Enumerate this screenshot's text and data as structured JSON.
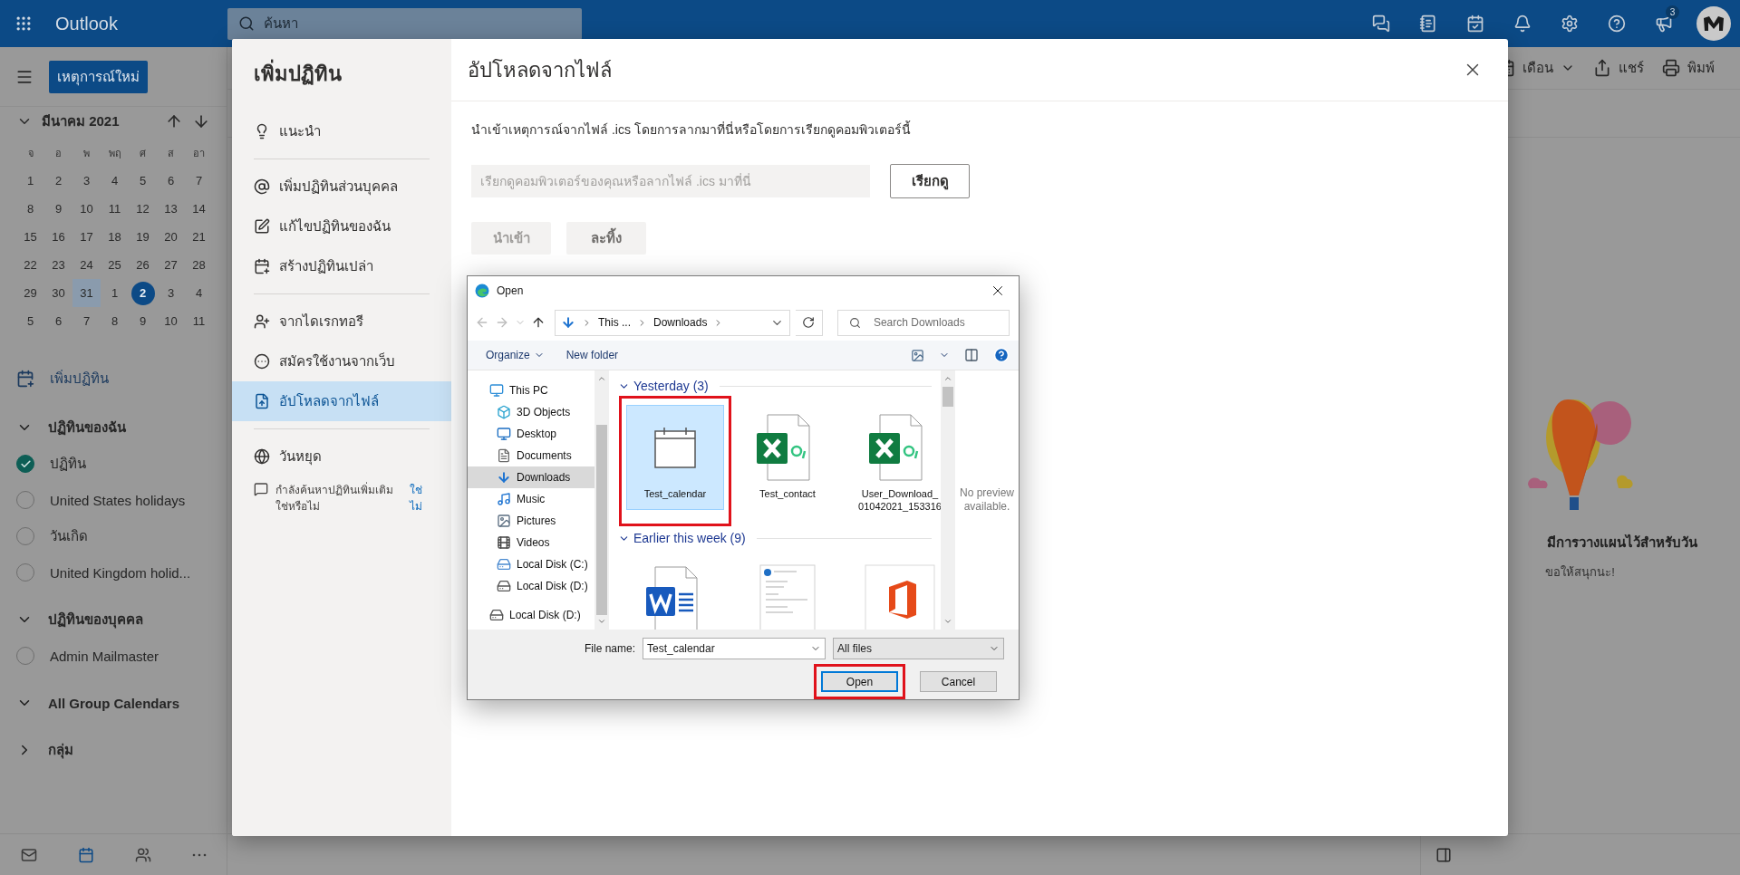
{
  "top_bar": {
    "app_name": "Outlook",
    "search": {
      "placeholder": "ค้นหา"
    },
    "icons": [
      {
        "kind": "chat"
      },
      {
        "kind": "notebook"
      },
      {
        "kind": "todo"
      },
      {
        "kind": "bell"
      },
      {
        "kind": "settings"
      },
      {
        "kind": "help"
      },
      {
        "kind": "megaphone",
        "badge": "3"
      }
    ]
  },
  "sidebar": {
    "new_event_button": "เหตุการณ์ใหม่",
    "mini_calendar": {
      "month": "มีนาคม 2021",
      "expanded": true,
      "weekdays": [
        "จ",
        "อ",
        "พ",
        "พฤ",
        "ศ",
        "ส",
        "อา"
      ],
      "weeks": [
        [
          {
            "day": "1",
            "selected": false,
            "today": false
          },
          {
            "day": "2",
            "selected": false,
            "today": false
          },
          {
            "day": "3",
            "selected": false,
            "today": false
          },
          {
            "day": "4",
            "selected": false,
            "today": false
          },
          {
            "day": "5",
            "selected": false,
            "today": false
          },
          {
            "day": "6",
            "selected": false,
            "today": false
          },
          {
            "day": "7",
            "selected": false,
            "today": false
          }
        ],
        [
          {
            "day": "8",
            "selected": false,
            "today": false
          },
          {
            "day": "9",
            "selected": false,
            "today": false
          },
          {
            "day": "10",
            "selected": false,
            "today": false
          },
          {
            "day": "11",
            "selected": false,
            "today": false
          },
          {
            "day": "12",
            "selected": false,
            "today": false
          },
          {
            "day": "13",
            "selected": false,
            "today": false
          },
          {
            "day": "14",
            "selected": false,
            "today": false
          }
        ],
        [
          {
            "day": "15",
            "selected": false,
            "today": false
          },
          {
            "day": "16",
            "selected": false,
            "today": false
          },
          {
            "day": "17",
            "selected": false,
            "today": false
          },
          {
            "day": "18",
            "selected": false,
            "today": false
          },
          {
            "day": "19",
            "selected": false,
            "today": false
          },
          {
            "day": "20",
            "selected": false,
            "today": false
          },
          {
            "day": "21",
            "selected": false,
            "today": false
          }
        ],
        [
          {
            "day": "22",
            "selected": false,
            "today": false
          },
          {
            "day": "23",
            "selected": false,
            "today": false
          },
          {
            "day": "24",
            "selected": false,
            "today": false
          },
          {
            "day": "25",
            "selected": false,
            "today": false
          },
          {
            "day": "26",
            "selected": false,
            "today": false
          },
          {
            "day": "27",
            "selected": false,
            "today": false
          },
          {
            "day": "28",
            "selected": false,
            "today": false
          }
        ],
        [
          {
            "day": "29",
            "selected": false,
            "today": false
          },
          {
            "day": "30",
            "selected": false,
            "today": false
          },
          {
            "day": "31",
            "selected": true,
            "today": false
          },
          {
            "day": "1",
            "selected": false,
            "today": false
          },
          {
            "day": "2",
            "selected": false,
            "today": true
          },
          {
            "day": "3",
            "selected": false,
            "today": false
          },
          {
            "day": "4",
            "selected": false,
            "today": false
          }
        ],
        [
          {
            "day": "5",
            "selected": false,
            "today": false
          },
          {
            "day": "6",
            "selected": false,
            "today": false
          },
          {
            "day": "7",
            "selected": false,
            "today": false
          },
          {
            "day": "8",
            "selected": false,
            "today": false
          },
          {
            "day": "9",
            "selected": false,
            "today": false
          },
          {
            "day": "10",
            "selected": false,
            "today": false
          },
          {
            "day": "11",
            "selected": false,
            "today": false
          }
        ]
      ]
    },
    "add_calendar": "เพิ่มปฏิทิน",
    "groups": [
      {
        "title": "ปฏิทินของฉัน",
        "expanded": true,
        "items": [
          {
            "label": "ปฏิทิน",
            "checked": true
          },
          {
            "label": "United States holidays",
            "checked": false
          },
          {
            "label": "วันเกิด",
            "checked": false
          },
          {
            "label": "United Kingdom holid...",
            "checked": false
          }
        ]
      },
      {
        "title": "ปฏิทินของบุคคล",
        "expanded": true,
        "items": [
          {
            "label": "Admin Mailmaster",
            "checked": false
          }
        ]
      },
      {
        "title": "All Group Calendars",
        "expanded": true
      },
      {
        "title": "กลุ่ม",
        "expanded": false
      }
    ],
    "bottom_nav": [
      {
        "kind": "mail",
        "selected": false
      },
      {
        "kind": "calendar",
        "selected": true
      },
      {
        "kind": "people",
        "selected": false
      },
      {
        "kind": "more",
        "selected": false
      }
    ]
  },
  "main": {
    "toolbar": [
      {
        "kind": "view",
        "label": "เดือน"
      },
      {
        "kind": "share",
        "label": "แชร์"
      },
      {
        "kind": "print",
        "label": "พิมพ์"
      }
    ],
    "day_pane": {
      "heading": "มีการวางแผนไว้สำหรับวัน",
      "subtext": "ขอให้สนุกนะ!"
    }
  },
  "add_calendar_dialog": {
    "title": "เพิ่มปฏิทิน",
    "menu_groups": [
      [
        {
          "label": "แนะนำ",
          "selected": false
        }
      ],
      [
        {
          "label": "เพิ่มปฏิทินส่วนบุคคล",
          "selected": false
        },
        {
          "label": "แก้ไขปฏิทินของฉัน",
          "selected": false
        },
        {
          "label": "สร้างปฏิทินเปล่า",
          "selected": false
        }
      ],
      [
        {
          "label": "จากไดเรกทอรี",
          "selected": false
        },
        {
          "label": "สมัครใช้งานจากเว็บ",
          "selected": false
        },
        {
          "label": "อัปโหลดจากไฟล์",
          "selected": true
        }
      ],
      [
        {
          "label": "วันหยุด",
          "selected": false
        }
      ]
    ],
    "feedback": {
      "text": "กำลังค้นหาปฏิทินเพิ่มเติมใช่หรือไม่",
      "links": [
        "ใช่",
        "ไม่"
      ]
    },
    "panel": {
      "title": "อัปโหลดจากไฟล์",
      "description": "นำเข้าเหตุการณ์จากไฟล์ .ics โดยการลากมาที่นี่หรือโดยการเรียกดูคอมพิวเตอร์นี้",
      "drop_field": {
        "placeholder": "เรียกดูคอมพิวเตอร์ของคุณหรือลากไฟล์ .ics มาที่นี่"
      },
      "browse_button": "เรียกดู",
      "actions": [
        {
          "label": "นำเข้า",
          "disabled": true
        },
        {
          "label": "ละทิ้ง",
          "disabled": false
        }
      ]
    }
  },
  "file_dialog": {
    "title": "Open",
    "address": [
      "This ...",
      "Downloads"
    ],
    "search": {
      "placeholder": "Search Downloads"
    },
    "toolbar": {
      "organize": "Organize",
      "new_folder": "New folder"
    },
    "nav_tree": [
      {
        "label": "This PC",
        "kind": "pc",
        "selected": false,
        "children": [
          {
            "label": "3D Objects",
            "kind": "objects",
            "selected": false
          },
          {
            "label": "Desktop",
            "kind": "desktop",
            "selected": false
          },
          {
            "label": "Documents",
            "kind": "documents",
            "selected": false
          },
          {
            "label": "Downloads",
            "kind": "downloads",
            "selected": true
          },
          {
            "label": "Music",
            "kind": "music",
            "selected": false
          },
          {
            "label": "Pictures",
            "kind": "pictures",
            "selected": false
          },
          {
            "label": "Videos",
            "kind": "videos",
            "selected": false
          },
          {
            "label": "Local Disk (C:)",
            "kind": "system_disk",
            "selected": false
          },
          {
            "label": "Local Disk (D:)",
            "kind": "disk",
            "selected": false
          }
        ]
      },
      {
        "label": "Local Disk (D:)",
        "kind": "disk",
        "selected": false
      }
    ],
    "groups": [
      {
        "title": "Yesterday (3)",
        "expanded": true,
        "files": [
          {
            "name": "Test_calendar",
            "kind": "calendar",
            "selected": true,
            "highlighted": true
          },
          {
            "name": "Test_contact",
            "kind": "excel",
            "selected": false,
            "highlighted": false
          },
          {
            "name": "User_Download_\n01042021_153316",
            "kind": "excel",
            "selected": false,
            "highlighted": false
          }
        ]
      },
      {
        "title": "Earlier this week (9)",
        "expanded": true,
        "files": [
          {
            "kind": "word",
            "selected": false,
            "highlighted": false
          },
          {
            "kind": "preview",
            "selected": false,
            "highlighted": false
          },
          {
            "kind": "office",
            "selected": false,
            "highlighted": false
          }
        ]
      }
    ],
    "preview_text": "No preview available.",
    "file_name": {
      "label": "File name:",
      "value": "Test_calendar"
    },
    "file_type": "All files",
    "buttons": [
      {
        "label": "Open",
        "kind": "primary",
        "highlighted": true
      },
      {
        "label": "Cancel",
        "kind": "secondary",
        "highlighted": false
      }
    ]
  }
}
